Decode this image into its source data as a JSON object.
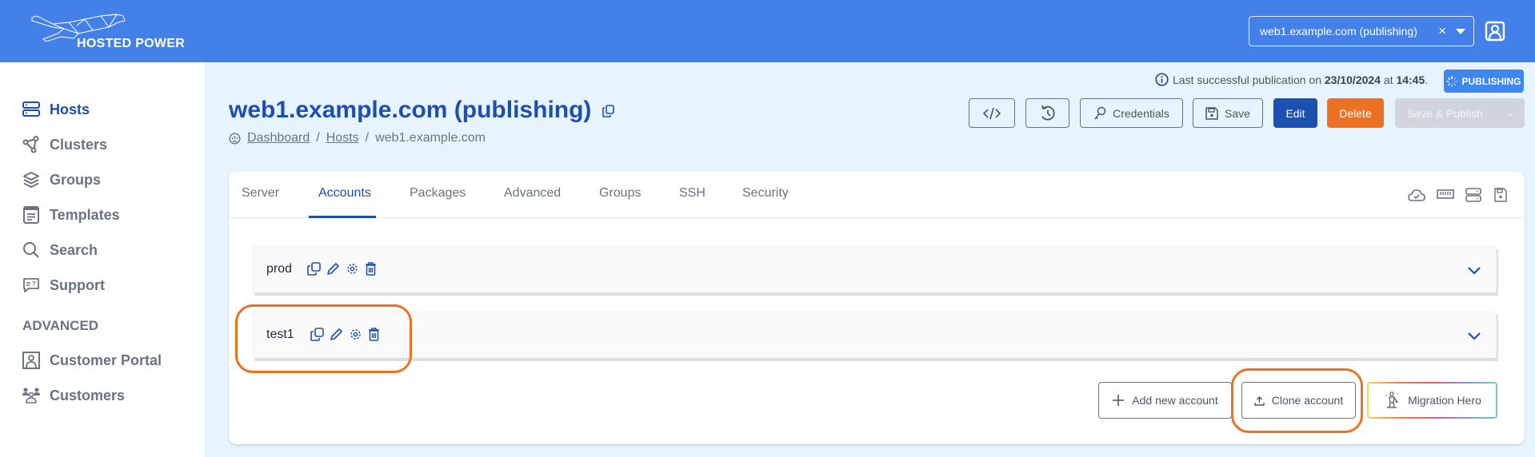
{
  "brand": {
    "name": "HOSTED POWER"
  },
  "topbar": {
    "host_selector": {
      "value": "web1.example.com (publishing)",
      "clear_icon": "close-icon",
      "caret_icon": "caret-down-icon"
    },
    "user_icon": "user-portrait-icon"
  },
  "sidebar": {
    "items": [
      {
        "label": "Hosts",
        "icon": "server-icon",
        "active": true
      },
      {
        "label": "Clusters",
        "icon": "cluster-icon"
      },
      {
        "label": "Groups",
        "icon": "layers-icon"
      },
      {
        "label": "Templates",
        "icon": "document-icon"
      },
      {
        "label": "Search",
        "icon": "search-icon"
      },
      {
        "label": "Support",
        "icon": "support-chat-icon"
      }
    ],
    "advanced_label": "ADVANCED",
    "advanced_items": [
      {
        "label": "Customer Portal",
        "icon": "portal-icon"
      },
      {
        "label": "Customers",
        "icon": "customers-icon"
      }
    ]
  },
  "publication": {
    "prefix": "Last successful publication on ",
    "date": "23/10/2024",
    "middle": " at ",
    "time": "14:45",
    "suffix": ".",
    "status_badge": "PUBLISHING"
  },
  "page": {
    "title": "web1.example.com (publishing)",
    "breadcrumb": [
      "Dashboard",
      "Hosts",
      "web1.example.com"
    ]
  },
  "toolbar": {
    "credentials_label": "Credentials",
    "save_label": "Save",
    "edit_label": "Edit",
    "delete_label": "Delete",
    "save_publish_label": "Save & Publish"
  },
  "tabs": [
    {
      "label": "Server"
    },
    {
      "label": "Accounts",
      "active": true
    },
    {
      "label": "Packages"
    },
    {
      "label": "Advanced"
    },
    {
      "label": "Groups"
    },
    {
      "label": "SSH"
    },
    {
      "label": "Security"
    }
  ],
  "accounts": [
    {
      "name": "prod"
    },
    {
      "name": "test1"
    }
  ],
  "account_actions": {
    "add_label": "Add new account",
    "clone_label": "Clone account",
    "hero_label": "Migration Hero"
  },
  "colors": {
    "brand_blue": "#4380e8",
    "primary": "#1b4fb0",
    "danger": "#ec7223",
    "annotation": "#ec7223"
  }
}
